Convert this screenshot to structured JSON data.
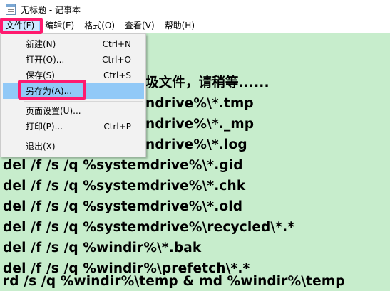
{
  "window": {
    "title": "无标题 - 记事本"
  },
  "menubar": {
    "items": [
      "文件(F)",
      "编辑(E)",
      "格式(O)",
      "查看(V)",
      "帮助(H)"
    ]
  },
  "file_menu": {
    "items": [
      {
        "label": "新建(N)",
        "shortcut": "Ctrl+N"
      },
      {
        "label": "打开(O)...",
        "shortcut": "Ctrl+O"
      },
      {
        "label": "保存(S)",
        "shortcut": "Ctrl+S"
      },
      {
        "label": "另存为(A)...",
        "shortcut": ""
      },
      {
        "label": "页面设置(U)...",
        "shortcut": ""
      },
      {
        "label": "打印(P)...",
        "shortcut": "Ctrl+P"
      },
      {
        "label": "退出(X)",
        "shortcut": ""
      }
    ],
    "highlighted": "另存为(A)..."
  },
  "editor": {
    "background": "#c7edcc",
    "lines": [
      "圾文件，请稍等......",
      "ndrive%\\*.tmp",
      "ndrive%\\*._mp",
      "ndrive%\\*.log",
      "del /f /s /q %systemdrive%\\*.gid",
      "del /f /s /q %systemdrive%\\*.chk",
      "del /f /s /q %systemdrive%\\*.old",
      "del /f /s /q %systemdrive%\\recycled\\*.*",
      "del /f /s /q %windir%\\*.bak",
      "del /f /s /q %windir%\\prefetch\\*.*",
      "rd /s /q %windir%\\temp & md %windir%\\temp"
    ]
  },
  "colors": {
    "highlight_annotation": "#ff1a6e",
    "menu_hover": "#91c9f7"
  }
}
